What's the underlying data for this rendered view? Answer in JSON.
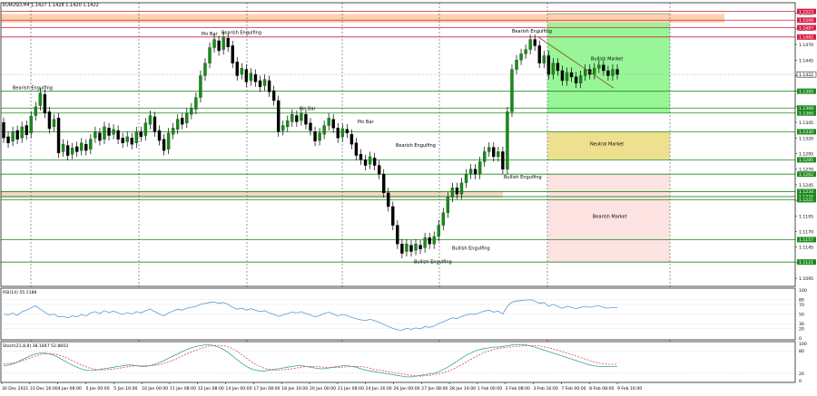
{
  "chart_data": {
    "type": "candlestick",
    "symbol_line": "EURUSD,H4  1.1427 1.1428 1.1420 1.1422",
    "price_axis": {
      "ylim": [
        1.1082,
        1.1537
      ],
      "ticks": [
        "1.1520",
        "1.1495",
        "1.1470",
        "1.1445",
        "1.1420",
        "1.1395",
        "1.1370",
        "1.1345",
        "1.1320",
        "1.1295",
        "1.1270",
        "1.1245",
        "1.1220",
        "1.1195",
        "1.1170",
        "1.1145",
        "1.1120",
        "1.1095"
      ],
      "current_price": "1.1422"
    },
    "time_axis": {
      "labels": [
        "30 Dec 2021",
        "31 Dec 16:00",
        "4 Jan 08:00",
        "5 Jan 00:00",
        "5 Jan 16:00",
        "10 Jan 00:00",
        "11 Jan 08:00",
        "12 Jan 08:00",
        "14 Jan 00:00",
        "17 Jan 08:00",
        "18 Jan 16:00",
        "20 Jan 00:00",
        "21 Jan 08:00",
        "24 Jan 16:00",
        "26 Jan 00:00",
        "27 Jan 08:00",
        "28 Jan 16:00",
        "1 Feb 00:00",
        "2 Feb 08:00",
        "3 Feb 16:00",
        "7 Feb 00:00",
        "8 Feb 08:00",
        "9 Feb 16:00"
      ]
    },
    "levels": [
      {
        "price": "1.1523",
        "color": "#d61f45",
        "style": "red"
      },
      {
        "price": "1.1509",
        "color": "#d61f45",
        "style": "red"
      },
      {
        "price": "1.1497",
        "color": "#d61f45",
        "style": "red"
      },
      {
        "price": "1.1482",
        "color": "#d61f45",
        "style": "red"
      },
      {
        "price": "1.1395",
        "color": "#1f8a1f",
        "style": "green"
      },
      {
        "price": "1.1368",
        "color": "#1f8a1f",
        "style": "green"
      },
      {
        "price": "1.1360",
        "color": "#1f8a1f",
        "style": "green"
      },
      {
        "price": "1.1330",
        "color": "#1f8a1f",
        "style": "green"
      },
      {
        "price": "1.1285",
        "color": "#1f8a1f",
        "style": "green"
      },
      {
        "price": "1.1262",
        "color": "#1f8a1f",
        "style": "green"
      },
      {
        "price": "1.1234",
        "color": "#1f8a1f",
        "style": "green"
      },
      {
        "price": "1.1226",
        "color": "#1f8a1f",
        "style": "green"
      },
      {
        "price": "1.1221",
        "color": "#1f8a1f",
        "style": "green"
      },
      {
        "price": "1.1157",
        "color": "#1f8a1f",
        "style": "green"
      },
      {
        "price": "1.1121",
        "color": "#1f8a1f",
        "style": "green"
      }
    ],
    "zones": [
      {
        "label": "Bullish Market",
        "from": 1.136,
        "to": 1.152,
        "color": "#98f598"
      },
      {
        "label": "Neutral Market",
        "from": 1.1285,
        "to": 1.133,
        "color": "#ede190"
      },
      {
        "label": "Bearish Market",
        "from": 1.1121,
        "to": 1.1262,
        "color": "#fde2e2"
      }
    ],
    "supply_bands": [
      {
        "from": 1.1505,
        "to": 1.1519,
        "color": "#fcd2ad"
      },
      {
        "from": 1.1224,
        "to": 1.1235,
        "color": "#f1d8c6"
      }
    ],
    "annotations": [
      "Bearish Engulfing",
      "Pin Bar",
      "Bearish Engulfing",
      "Pin Bar",
      "Pin Bar",
      "Bearish Engulfing",
      "Bullish Engulfing",
      "Bullish Engulfing",
      "Bearish Engulfing",
      "Bullish Engulfing"
    ],
    "zone_labels": [
      "Bullish Market",
      "Neutral Market",
      "Bearish Market"
    ],
    "candles": [
      [
        1.1345,
        1.132
      ],
      [
        1.1322,
        1.1312
      ],
      [
        1.1315,
        1.133
      ],
      [
        1.1332,
        1.1318
      ],
      [
        1.132,
        1.1338
      ],
      [
        1.134,
        1.1325
      ],
      [
        1.1328,
        1.1355
      ],
      [
        1.1356,
        1.137
      ],
      [
        1.1372,
        1.1392
      ],
      [
        1.139,
        1.136
      ],
      [
        1.1362,
        1.1335
      ],
      [
        1.1338,
        1.135
      ],
      [
        1.1352,
        1.1296
      ],
      [
        1.1298,
        1.131
      ],
      [
        1.1308,
        1.1292
      ],
      [
        1.1294,
        1.1304
      ],
      [
        1.1306,
        1.1298
      ],
      [
        1.13,
        1.1312
      ],
      [
        1.131,
        1.13
      ],
      [
        1.1302,
        1.1318
      ],
      [
        1.132,
        1.133
      ],
      [
        1.1328,
        1.1316
      ],
      [
        1.1318,
        1.1338
      ],
      [
        1.1336,
        1.1324
      ],
      [
        1.1326,
        1.1334
      ],
      [
        1.1332,
        1.1318
      ],
      [
        1.132,
        1.1312
      ],
      [
        1.1314,
        1.1322
      ],
      [
        1.132,
        1.131
      ],
      [
        1.1312,
        1.133
      ],
      [
        1.133,
        1.1322
      ],
      [
        1.1324,
        1.1344
      ],
      [
        1.1342,
        1.1356
      ],
      [
        1.1354,
        1.133
      ],
      [
        1.1332,
        1.1316
      ],
      [
        1.1318,
        1.13
      ],
      [
        1.1302,
        1.1328
      ],
      [
        1.1326,
        1.1336
      ],
      [
        1.1334,
        1.135
      ],
      [
        1.1352,
        1.1342
      ],
      [
        1.1344,
        1.136
      ],
      [
        1.1358,
        1.1368
      ],
      [
        1.1366,
        1.1385
      ],
      [
        1.1385,
        1.142
      ],
      [
        1.142,
        1.144
      ],
      [
        1.144,
        1.1465
      ],
      [
        1.1465,
        1.1478
      ],
      [
        1.1476,
        1.146
      ],
      [
        1.1462,
        1.1482
      ],
      [
        1.148,
        1.1466
      ],
      [
        1.1468,
        1.144
      ],
      [
        1.1442,
        1.142
      ],
      [
        1.1422,
        1.1432
      ],
      [
        1.143,
        1.141
      ],
      [
        1.1412,
        1.1424
      ],
      [
        1.1422,
        1.141
      ],
      [
        1.1412,
        1.1402
      ],
      [
        1.1404,
        1.1414
      ],
      [
        1.1412,
        1.1394
      ],
      [
        1.1396,
        1.138
      ],
      [
        1.138,
        1.133
      ],
      [
        1.1332,
        1.134
      ],
      [
        1.1338,
        1.1348
      ],
      [
        1.1346,
        1.1358
      ],
      [
        1.1356,
        1.1346
      ],
      [
        1.1348,
        1.136
      ],
      [
        1.1358,
        1.1342
      ],
      [
        1.1344,
        1.1332
      ],
      [
        1.133,
        1.1315
      ],
      [
        1.1316,
        1.1328
      ],
      [
        1.1326,
        1.134
      ],
      [
        1.134,
        1.1352
      ],
      [
        1.135,
        1.1336
      ],
      [
        1.1336,
        1.132
      ],
      [
        1.1322,
        1.1335
      ],
      [
        1.1334,
        1.1328
      ],
      [
        1.1326,
        1.131
      ],
      [
        1.1312,
        1.1292
      ],
      [
        1.1294,
        1.1285
      ],
      [
        1.1285,
        1.1276
      ],
      [
        1.1278,
        1.129
      ],
      [
        1.1288,
        1.1276
      ],
      [
        1.1276,
        1.1262
      ],
      [
        1.1262,
        1.1232
      ],
      [
        1.1232,
        1.121
      ],
      [
        1.121,
        1.118
      ],
      [
        1.118,
        1.115
      ],
      [
        1.115,
        1.1135
      ],
      [
        1.1138,
        1.115
      ],
      [
        1.1148,
        1.1138
      ],
      [
        1.114,
        1.115
      ],
      [
        1.1148,
        1.1142
      ],
      [
        1.1144,
        1.116
      ],
      [
        1.116,
        1.115
      ],
      [
        1.115,
        1.1162
      ],
      [
        1.1162,
        1.118
      ],
      [
        1.118,
        1.12
      ],
      [
        1.12,
        1.1225
      ],
      [
        1.1225,
        1.124
      ],
      [
        1.124,
        1.123
      ],
      [
        1.123,
        1.1248
      ],
      [
        1.1248,
        1.1262
      ],
      [
        1.1262,
        1.127
      ],
      [
        1.127,
        1.1262
      ],
      [
        1.1262,
        1.1282
      ],
      [
        1.1282,
        1.1298
      ],
      [
        1.1298,
        1.1305
      ],
      [
        1.1305,
        1.129
      ],
      [
        1.129,
        1.1298
      ],
      [
        1.1298,
        1.127
      ],
      [
        1.127,
        1.1362
      ],
      [
        1.1362,
        1.143
      ],
      [
        1.143,
        1.1445
      ],
      [
        1.1445,
        1.1455
      ],
      [
        1.1455,
        1.1462
      ],
      [
        1.1462,
        1.1478
      ],
      [
        1.1478,
        1.1468
      ],
      [
        1.1468,
        1.144
      ],
      [
        1.144,
        1.1452
      ],
      [
        1.1452,
        1.1422
      ],
      [
        1.1422,
        1.144
      ],
      [
        1.144,
        1.1428
      ],
      [
        1.1428,
        1.1412
      ],
      [
        1.1412,
        1.1425
      ],
      [
        1.1425,
        1.1418
      ],
      [
        1.1418,
        1.1408
      ],
      [
        1.1408,
        1.142
      ],
      [
        1.142,
        1.143
      ],
      [
        1.143,
        1.1422
      ],
      [
        1.1422,
        1.1432
      ],
      [
        1.1432,
        1.1437
      ],
      [
        1.1437,
        1.1428
      ],
      [
        1.1428,
        1.142
      ],
      [
        1.142,
        1.143
      ],
      [
        1.143,
        1.1422
      ]
    ],
    "rsi": {
      "label": "RSI(14) 55.1188",
      "levels": [
        "100",
        "80",
        "70",
        "50",
        "30",
        "20",
        "0"
      ],
      "values": [
        50,
        48,
        52,
        47,
        55,
        58,
        63,
        67,
        60,
        54,
        48,
        50,
        44,
        45,
        42,
        46,
        44,
        49,
        46,
        52,
        55,
        51,
        57,
        53,
        56,
        52,
        49,
        53,
        50,
        55,
        52,
        57,
        60,
        55,
        50,
        46,
        52,
        56,
        60,
        58,
        62,
        64,
        66,
        70,
        72,
        74,
        75,
        72,
        74,
        70,
        64,
        60,
        62,
        58,
        61,
        58,
        55,
        57,
        52,
        49,
        45,
        48,
        51,
        54,
        52,
        55,
        51,
        48,
        44,
        47,
        51,
        54,
        50,
        46,
        49,
        47,
        43,
        40,
        38,
        36,
        39,
        36,
        33,
        28,
        24,
        20,
        17,
        16,
        20,
        18,
        21,
        19,
        24,
        22,
        25,
        30,
        34,
        38,
        42,
        40,
        45,
        48,
        50,
        49,
        53,
        56,
        58,
        54,
        56,
        50,
        66,
        75,
        77,
        78,
        79,
        80,
        77,
        72,
        74,
        66,
        70,
        66,
        62,
        66,
        64,
        61,
        64,
        66,
        64,
        66,
        67,
        64,
        62,
        64,
        63
      ]
    },
    "stoch": {
      "label": "Stoch(21,8,8) 38.1847 52.8603",
      "levels": [
        "100",
        "80",
        "20",
        "0"
      ],
      "k": [
        40,
        42,
        45,
        50,
        56,
        62,
        68,
        72,
        74,
        74,
        72,
        68,
        62,
        55,
        48,
        42,
        36,
        31,
        28,
        27,
        28,
        30,
        32,
        34,
        36,
        38,
        40,
        42,
        42,
        40,
        38,
        38,
        40,
        44,
        48,
        54,
        60,
        66,
        72,
        78,
        84,
        88,
        92,
        94,
        96,
        96,
        94,
        90,
        84,
        76,
        66,
        56,
        46,
        38,
        32,
        28,
        26,
        26,
        28,
        30,
        32,
        34,
        36,
        38,
        40,
        40,
        38,
        36,
        34,
        32,
        32,
        34,
        36,
        38,
        40,
        40,
        38,
        36,
        32,
        28,
        26,
        24,
        22,
        20,
        18,
        16,
        14,
        12,
        10,
        10,
        12,
        14,
        16,
        18,
        20,
        24,
        30,
        36,
        44,
        52,
        60,
        68,
        74,
        80,
        84,
        86,
        88,
        90,
        90,
        92,
        94,
        96,
        97,
        97,
        96,
        94,
        90,
        86,
        82,
        78,
        74,
        70,
        66,
        62,
        58,
        54,
        50,
        46,
        42,
        40,
        38,
        38,
        38,
        38,
        38
      ],
      "d": [
        45,
        46,
        47,
        49,
        53,
        57,
        62,
        66,
        70,
        72,
        73,
        72,
        69,
        65,
        60,
        54,
        48,
        42,
        37,
        33,
        30,
        29,
        29,
        30,
        31,
        33,
        35,
        37,
        39,
        40,
        40,
        40,
        40,
        41,
        43,
        46,
        50,
        55,
        60,
        66,
        72,
        77,
        82,
        86,
        90,
        93,
        95,
        95,
        94,
        91,
        86,
        79,
        70,
        61,
        52,
        44,
        38,
        33,
        30,
        28,
        28,
        29,
        30,
        32,
        34,
        36,
        38,
        38,
        38,
        37,
        36,
        35,
        35,
        35,
        36,
        37,
        38,
        38,
        38,
        36,
        33,
        30,
        28,
        26,
        24,
        22,
        20,
        18,
        16,
        14,
        13,
        12,
        13,
        14,
        16,
        18,
        21,
        25,
        30,
        36,
        43,
        50,
        57,
        64,
        70,
        76,
        80,
        84,
        86,
        88,
        90,
        91,
        92,
        93,
        94,
        94,
        94,
        93,
        91,
        88,
        85,
        82,
        78,
        74,
        70,
        66,
        62,
        58,
        54,
        50,
        47,
        45,
        44,
        44,
        44
      ]
    }
  }
}
